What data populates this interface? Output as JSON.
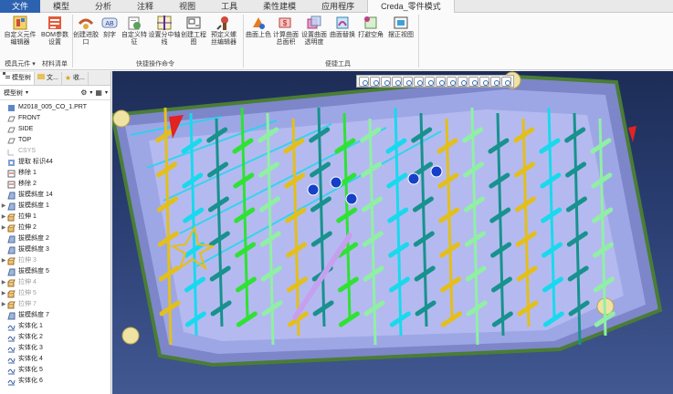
{
  "ribbon_tabs": [
    {
      "label": "文件"
    },
    {
      "label": "模型"
    },
    {
      "label": "分析"
    },
    {
      "label": "注释"
    },
    {
      "label": "视图"
    },
    {
      "label": "工具"
    },
    {
      "label": "柔性建模"
    },
    {
      "label": "应用程序"
    },
    {
      "label": "Creda_零件模式"
    }
  ],
  "ribbon_groups": [
    {
      "label": "模具元件 ▾"
    },
    {
      "label": "材料清单"
    },
    {
      "label": "快捷操作命令"
    },
    {
      "label": "便捷工具"
    }
  ],
  "ribbon_buttons": [
    {
      "label": "自定义元件编辑器",
      "icon": "component-editor-icon"
    },
    {
      "label": "BOM参数设置",
      "icon": "bom-icon"
    },
    {
      "label": "创建进胶口",
      "icon": "gate-icon"
    },
    {
      "label": "刻字",
      "icon": "engrave-icon"
    },
    {
      "label": "自定义特征",
      "icon": "feature-icon"
    },
    {
      "label": "设置分中轴线",
      "icon": "axis-icon"
    },
    {
      "label": "创建工程图",
      "icon": "drawing-icon"
    },
    {
      "label": "预定义螺丝编辑器",
      "icon": "screw-icon"
    },
    {
      "label": "曲面上色",
      "icon": "surface-color-icon"
    },
    {
      "label": "计算曲面总面积",
      "icon": "area-icon"
    },
    {
      "label": "设置曲面透明度",
      "icon": "transparency-icon"
    },
    {
      "label": "曲面替换",
      "icon": "replace-icon"
    },
    {
      "label": "打避空角",
      "icon": "corner-icon"
    },
    {
      "label": "摆正视图",
      "icon": "view-icon"
    }
  ],
  "panel": {
    "tabs": [
      {
        "label": "模型树"
      },
      {
        "label": "文..."
      },
      {
        "label": "收..."
      }
    ],
    "toolbar_label": "模型树"
  },
  "tree": [
    {
      "label": "M2018_005_CO_1.PRT",
      "icon": "part-icon",
      "expand": "",
      "dim": false
    },
    {
      "label": "FRONT",
      "icon": "plane-icon",
      "expand": "",
      "dim": false
    },
    {
      "label": "SIDE",
      "icon": "plane-icon",
      "expand": "",
      "dim": false
    },
    {
      "label": "TOP",
      "icon": "plane-icon",
      "expand": "",
      "dim": false
    },
    {
      "label": "CSYS",
      "icon": "csys-icon",
      "expand": "",
      "dim": true
    },
    {
      "label": "提取 标识44",
      "icon": "extract-icon",
      "expand": "",
      "dim": false
    },
    {
      "label": "移除 1",
      "icon": "remove-icon",
      "expand": "",
      "dim": false
    },
    {
      "label": "移除 2",
      "icon": "remove-icon",
      "expand": "",
      "dim": false
    },
    {
      "label": "拔模斜度 14",
      "icon": "draft-icon",
      "expand": "",
      "dim": false
    },
    {
      "label": "拔模斜度 1",
      "icon": "draft-icon",
      "expand": "▶",
      "dim": false
    },
    {
      "label": "拉伸 1",
      "icon": "extrude-icon",
      "expand": "▶",
      "dim": false
    },
    {
      "label": "拉伸 2",
      "icon": "extrude-icon",
      "expand": "▶",
      "dim": false
    },
    {
      "label": "拔模斜度 2",
      "icon": "draft-icon",
      "expand": "",
      "dim": false
    },
    {
      "label": "拔模斜度 3",
      "icon": "draft-icon",
      "expand": "",
      "dim": false
    },
    {
      "label": "拉伸 3",
      "icon": "extrude-icon",
      "expand": "▶",
      "dim": true
    },
    {
      "label": "拔模斜度 5",
      "icon": "draft-icon",
      "expand": "",
      "dim": false
    },
    {
      "label": "拉伸 4",
      "icon": "extrude-icon",
      "expand": "▶",
      "dim": true
    },
    {
      "label": "拉伸 5",
      "icon": "extrude-icon",
      "expand": "▶",
      "dim": true
    },
    {
      "label": "拉伸 7",
      "icon": "extrude-icon",
      "expand": "▶",
      "dim": true
    },
    {
      "label": "拔模斜度 7",
      "icon": "draft-icon",
      "expand": "",
      "dim": false
    },
    {
      "label": "实体化 1",
      "icon": "solidify-icon",
      "expand": "",
      "dim": false
    },
    {
      "label": "实体化 2",
      "icon": "solidify-icon",
      "expand": "",
      "dim": false
    },
    {
      "label": "实体化 3",
      "icon": "solidify-icon",
      "expand": "",
      "dim": false
    },
    {
      "label": "实体化 4",
      "icon": "solidify-icon",
      "expand": "",
      "dim": false
    },
    {
      "label": "实体化 5",
      "icon": "solidify-icon",
      "expand": "",
      "dim": false
    },
    {
      "label": "实体化 6",
      "icon": "solidify-icon",
      "expand": "",
      "dim": false
    }
  ],
  "view_toolbar_icons": [
    "zoom-fit-icon",
    "zoom-in-icon",
    "zoom-out-icon",
    "repaint-icon",
    "orient-icon",
    "saved-views-icon",
    "display-style-icon",
    "datum-display-icon",
    "plane-display-icon",
    "axis-display-icon",
    "point-display-icon",
    "csys-display-icon",
    "annotation-display-icon",
    "spin-center-icon"
  ],
  "colors": {
    "file_tab": "#2c62b0",
    "viewport_bg": "#1d2d57",
    "mold_base": "#9ea7e6",
    "mold_frame": "#7d86c9",
    "rail_green": "#4a7d35",
    "pin_cyan": "#19d9ee",
    "pin_teal": "#17928e",
    "pin_yellow": "#e3bf1c",
    "pin_green": "#2fe233",
    "pin_light_green": "#8ff0a4",
    "pin_blue": "#1640c8",
    "pin_violet": "#c6a0f0",
    "accent_red": "#e2231f"
  }
}
